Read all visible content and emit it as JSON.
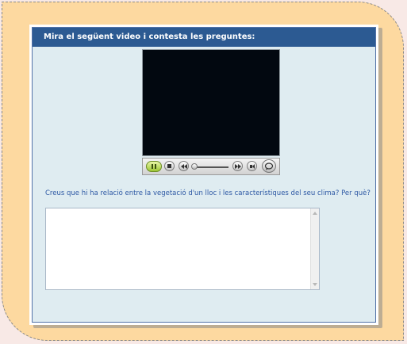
{
  "panel": {
    "heading": "Mira el següent video i contesta les preguntes:"
  },
  "video": {
    "controls": [
      "play-pause-icon",
      "stop-icon",
      "rewind-icon",
      "seek-slider",
      "fast-forward-icon",
      "volume-icon",
      "player-logo-icon"
    ],
    "progress": 0
  },
  "question": {
    "text": "Creus que hi ha relació entre la vegetació d'un lloc i les característiques del seu clima? Per què?"
  },
  "answer": {
    "value": ""
  },
  "colors": {
    "frame": "#fdd9a0",
    "header": "#2c5a92",
    "panel_bg": "#dfecf1",
    "question_text": "#2d58a4"
  }
}
